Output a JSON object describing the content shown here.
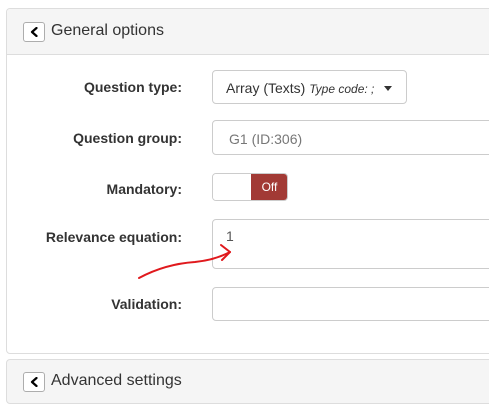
{
  "general_panel": {
    "title": "General options",
    "toggle_icon": "chevron-left-icon"
  },
  "fields": {
    "question_type": {
      "label": "Question type:",
      "value": "Array (Texts)",
      "type_code": "Type code: ;"
    },
    "question_group": {
      "label": "Question group:",
      "value": "G1 (ID:306)"
    },
    "mandatory": {
      "label": "Mandatory:",
      "state": "Off",
      "state_color": "#a23a35"
    },
    "relevance": {
      "label": "Relevance equation:",
      "value": "1"
    },
    "validation": {
      "label": "Validation:",
      "value": ""
    }
  },
  "advanced_panel": {
    "title": "Advanced settings",
    "toggle_icon": "chevron-left-icon"
  },
  "annotation": {
    "color": "#e0191d",
    "icon": "red-arrow-annotation"
  }
}
